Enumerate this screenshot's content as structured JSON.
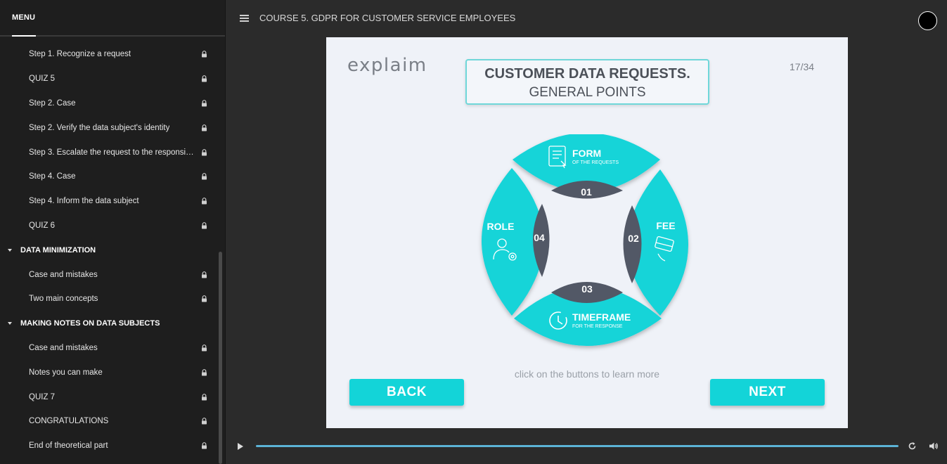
{
  "sidebar": {
    "menu_label": "MENU",
    "items": [
      {
        "type": "item",
        "label": "Step 1. Recognize a request",
        "icon": "lock-icon"
      },
      {
        "type": "item",
        "label": "QUIZ 5",
        "icon": "lock-icon"
      },
      {
        "type": "item",
        "label": "Step 2. Case",
        "icon": "lock-icon"
      },
      {
        "type": "item",
        "label": "Step 2. Verify the data subject's identity",
        "icon": "lock-icon"
      },
      {
        "type": "item",
        "label": "Step 3. Escalate the request to the responsible ...",
        "icon": "lock-icon"
      },
      {
        "type": "item",
        "label": "Step 4. Case",
        "icon": "lock-icon"
      },
      {
        "type": "item",
        "label": "Step 4. Inform the data subject",
        "icon": "lock-icon"
      },
      {
        "type": "item",
        "label": "QUIZ 6",
        "icon": "lock-icon"
      },
      {
        "type": "section",
        "label": "DATA MINIMIZATION"
      },
      {
        "type": "item",
        "label": "Case and mistakes",
        "icon": "lock-icon"
      },
      {
        "type": "item",
        "label": "Two main concepts",
        "icon": "lock-icon"
      },
      {
        "type": "section",
        "label": "MAKING NOTES ON DATA SUBJECTS"
      },
      {
        "type": "item",
        "label": "Case and mistakes",
        "icon": "lock-icon"
      },
      {
        "type": "item",
        "label": "Notes you can make",
        "icon": "lock-icon"
      },
      {
        "type": "item",
        "label": "QUIZ 7",
        "icon": "lock-icon"
      },
      {
        "type": "item",
        "label": "CONGRATULATIONS",
        "icon": "lock-icon"
      },
      {
        "type": "item",
        "label": "End of theoretical part",
        "icon": "lock-icon"
      }
    ]
  },
  "header": {
    "course_title": "COURSE 5. GDPR FOR CUSTOMER SERVICE EMPLOYEES"
  },
  "slide": {
    "logo": "explaim",
    "title_line1": "CUSTOMER DATA REQUESTS.",
    "title_line2": "GENERAL POINTS",
    "page_counter": "17/34",
    "segments": {
      "form": {
        "number": "01",
        "title": "FORM",
        "subtitle": "OF THE REQUESTS"
      },
      "fee": {
        "number": "02",
        "title": "FEE"
      },
      "timeframe": {
        "number": "03",
        "title": "TIMEFRAME",
        "subtitle": "FOR THE RESPONSE"
      },
      "role": {
        "number": "04",
        "title": "ROLE"
      }
    },
    "hint": "click on the buttons to learn more",
    "back_label": "BACK",
    "next_label": "NEXT"
  },
  "colors": {
    "accent": "#13d4d8",
    "number_band": "#525866",
    "sidebar_bg": "#1e1e1e",
    "app_bg": "#2b2b2b",
    "progress": "#5cb3d6"
  }
}
